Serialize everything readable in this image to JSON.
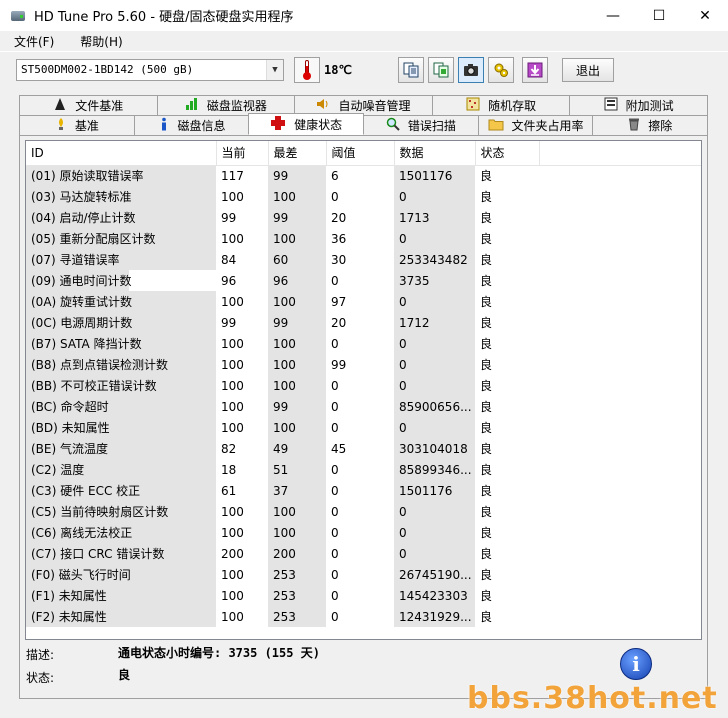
{
  "window": {
    "title": "HD Tune Pro 5.60 - 硬盘/固态硬盘实用程序",
    "min_glyph": "—",
    "max_glyph": "☐",
    "close_glyph": "✕"
  },
  "menu": [
    "文件(F)",
    "帮助(H)"
  ],
  "toolbar": {
    "drive": "ST500DM002-1BD142 (500 gB)",
    "temperature": "18℃",
    "exit_label": "退出",
    "buttons": [
      "copy-text-icon",
      "copy-screen-icon",
      "camera-icon",
      "settings-icon",
      "save-icon"
    ]
  },
  "tabs_top": [
    {
      "label": "文件基准",
      "icon": "file-benchmark-icon"
    },
    {
      "label": "磁盘监视器",
      "icon": "disk-monitor-icon"
    },
    {
      "label": "自动噪音管理",
      "icon": "speaker-icon"
    },
    {
      "label": "随机存取",
      "icon": "random-access-icon"
    },
    {
      "label": "附加测试",
      "icon": "extra-tests-icon"
    }
  ],
  "tabs_bottom": [
    {
      "label": "基准",
      "icon": "benchmark-icon"
    },
    {
      "label": "磁盘信息",
      "icon": "info-icon"
    },
    {
      "label": "健康状态",
      "icon": "health-cross-icon",
      "active": true
    },
    {
      "label": "错误扫描",
      "icon": "magnifier-icon"
    },
    {
      "label": "文件夹占用率",
      "icon": "folder-icon"
    },
    {
      "label": "擦除",
      "icon": "trash-icon"
    }
  ],
  "table": {
    "headers": [
      "ID",
      "当前",
      "最差",
      "阈值",
      "数据",
      "状态"
    ],
    "rows": [
      [
        "(01) 原始读取错误率",
        "117",
        "99",
        "6",
        "1501176",
        "良"
      ],
      [
        "(03) 马达旋转标准",
        "100",
        "100",
        "0",
        "0",
        "良"
      ],
      [
        "(04) 启动/停止计数",
        "99",
        "99",
        "20",
        "1713",
        "良"
      ],
      [
        "(05) 重新分配扇区计数",
        "100",
        "100",
        "36",
        "0",
        "良"
      ],
      [
        "(07) 寻道错误率",
        "84",
        "60",
        "30",
        "253343482",
        "良"
      ],
      [
        "(09) 通电时间计数",
        "96",
        "96",
        "0",
        "3735",
        "良"
      ],
      [
        "(0A) 旋转重试计数",
        "100",
        "100",
        "97",
        "0",
        "良"
      ],
      [
        "(0C) 电源周期计数",
        "99",
        "99",
        "20",
        "1712",
        "良"
      ],
      [
        "(B7) SATA 降挡计数",
        "100",
        "100",
        "0",
        "0",
        "良"
      ],
      [
        "(B8) 点到点错误检测计数",
        "100",
        "100",
        "99",
        "0",
        "良"
      ],
      [
        "(BB) 不可校正错误计数",
        "100",
        "100",
        "0",
        "0",
        "良"
      ],
      [
        "(BC) 命令超时",
        "100",
        "99",
        "0",
        "85900656...",
        "良"
      ],
      [
        "(BD) 未知属性",
        "100",
        "100",
        "0",
        "0",
        "良"
      ],
      [
        "(BE) 气流温度",
        "82",
        "49",
        "45",
        "303104018",
        "良"
      ],
      [
        "(C2) 温度",
        "18",
        "51",
        "0",
        "85899346...",
        "良"
      ],
      [
        "(C3) 硬件 ECC 校正",
        "61",
        "37",
        "0",
        "1501176",
        "良"
      ],
      [
        "(C5) 当前待映射扇区计数",
        "100",
        "100",
        "0",
        "0",
        "良"
      ],
      [
        "(C6) 离线无法校正",
        "100",
        "100",
        "0",
        "0",
        "良"
      ],
      [
        "(C7) 接口 CRC 错误计数",
        "200",
        "200",
        "0",
        "0",
        "良"
      ],
      [
        "(F0) 磁头飞行时间",
        "100",
        "253",
        "0",
        "26745190...",
        "良"
      ],
      [
        "(F1) 未知属性",
        "100",
        "253",
        "0",
        "145423303",
        "良"
      ],
      [
        "(F2) 未知属性",
        "100",
        "253",
        "0",
        "12431929...",
        "良"
      ]
    ]
  },
  "detail": {
    "desc_label": "描述:",
    "desc_value": "通电状态小时编号: 3735 (155 天)",
    "status_label": "状态:",
    "status_value": "良"
  },
  "watermark": "bbs.38hot.net"
}
